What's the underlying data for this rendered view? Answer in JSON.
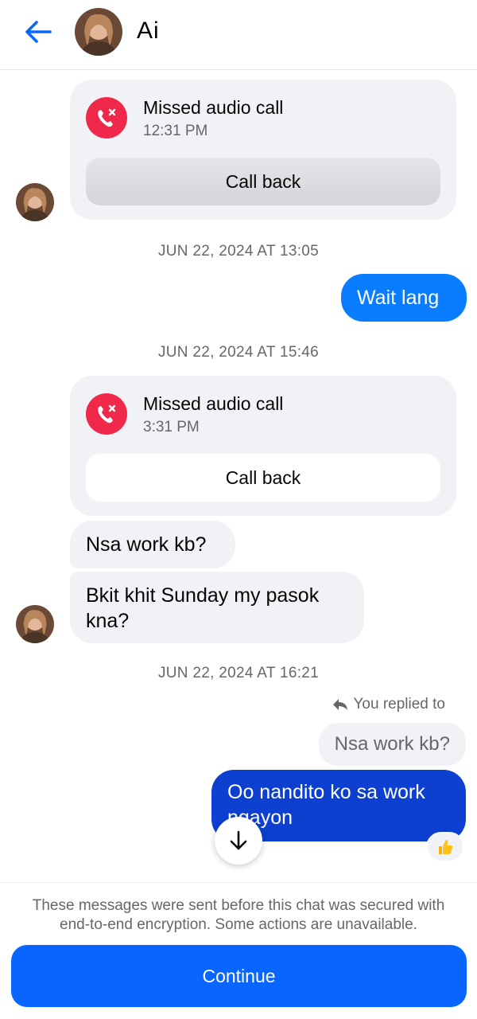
{
  "header": {
    "contact_name": "Ai"
  },
  "messages": {
    "call1": {
      "title": "Missed audio call",
      "time": "12:31 PM",
      "action": "Call back"
    },
    "ts1": "JUN 22, 2024 AT 13:05",
    "out1": "Wait lang",
    "ts2": "JUN 22, 2024 AT 15:46",
    "call2": {
      "title": "Missed audio call",
      "time": "3:31 PM",
      "action": "Call back"
    },
    "in1": "Nsa work kb?",
    "in2_line1": "Bkit khit Sunday my pasok",
    "in2_line2": "kna?",
    "ts3": "JUN 22, 2024 AT 16:21",
    "replied_label": "You replied to",
    "quoted": "Nsa work kb?",
    "out2_line1": "Oo nandito ko sa work",
    "out2_line2": "ngayon",
    "reaction": "thumbs-up"
  },
  "footer": {
    "notice_line1": "These messages were sent before this chat was secured with",
    "notice_line2": "end-to-end encryption. Some actions are unavailable.",
    "continue_label": "Continue"
  },
  "colors": {
    "accent": "#0866ff",
    "bubble_out": "#0a7cff",
    "missed_call": "#f02849",
    "bubble_in": "#f0f2f5"
  },
  "icons": [
    "back-arrow-icon",
    "missed-call-icon",
    "reply-arrow-icon",
    "scroll-down-icon",
    "thumbs-up-icon",
    "avatar"
  ]
}
